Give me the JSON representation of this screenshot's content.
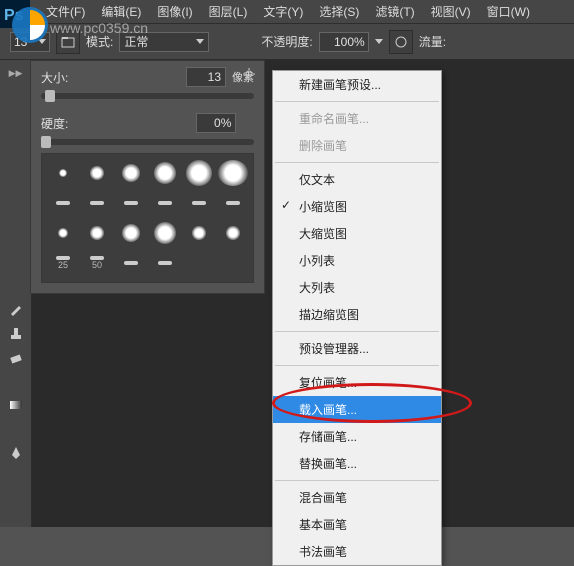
{
  "menubar": {
    "items": [
      "文件(F)",
      "编辑(E)",
      "图像(I)",
      "图层(L)",
      "文字(Y)",
      "选择(S)",
      "滤镜(T)",
      "视图(V)",
      "窗口(W)"
    ]
  },
  "optionsbar": {
    "size_value": "13",
    "mode_label": "模式:",
    "mode_value": "正常",
    "opacity_label": "不透明度:",
    "opacity_value": "100%",
    "flow_label": "流量:"
  },
  "brush_panel": {
    "size_label": "大小:",
    "size_value": "13",
    "size_unit": "像素",
    "hardness_label": "硬度:",
    "hardness_value": "0%",
    "swatch_sizes": [
      "",
      "",
      "",
      "",
      "",
      "",
      "",
      "",
      "",
      "",
      "",
      "",
      "",
      "",
      "",
      "",
      "",
      "",
      "25",
      "50",
      "",
      ""
    ]
  },
  "context_menu": {
    "items": [
      {
        "label": "新建画笔预设...",
        "type": "item"
      },
      {
        "type": "sep"
      },
      {
        "label": "重命名画笔...",
        "type": "item",
        "disabled": true
      },
      {
        "label": "删除画笔",
        "type": "item",
        "disabled": true
      },
      {
        "type": "sep"
      },
      {
        "label": "仅文本",
        "type": "item"
      },
      {
        "label": "小缩览图",
        "type": "item",
        "checked": true
      },
      {
        "label": "大缩览图",
        "type": "item"
      },
      {
        "label": "小列表",
        "type": "item"
      },
      {
        "label": "大列表",
        "type": "item"
      },
      {
        "label": "描边缩览图",
        "type": "item"
      },
      {
        "type": "sep"
      },
      {
        "label": "预设管理器...",
        "type": "item"
      },
      {
        "type": "sep"
      },
      {
        "label": "复位画笔...",
        "type": "item"
      },
      {
        "label": "载入画笔...",
        "type": "item",
        "highlight": true
      },
      {
        "label": "存储画笔...",
        "type": "item"
      },
      {
        "label": "替换画笔...",
        "type": "item"
      },
      {
        "type": "sep"
      },
      {
        "label": "混合画笔",
        "type": "item"
      },
      {
        "label": "基本画笔",
        "type": "item"
      },
      {
        "label": "书法画笔",
        "type": "item"
      }
    ]
  },
  "watermark": "www.pc0359.cn"
}
